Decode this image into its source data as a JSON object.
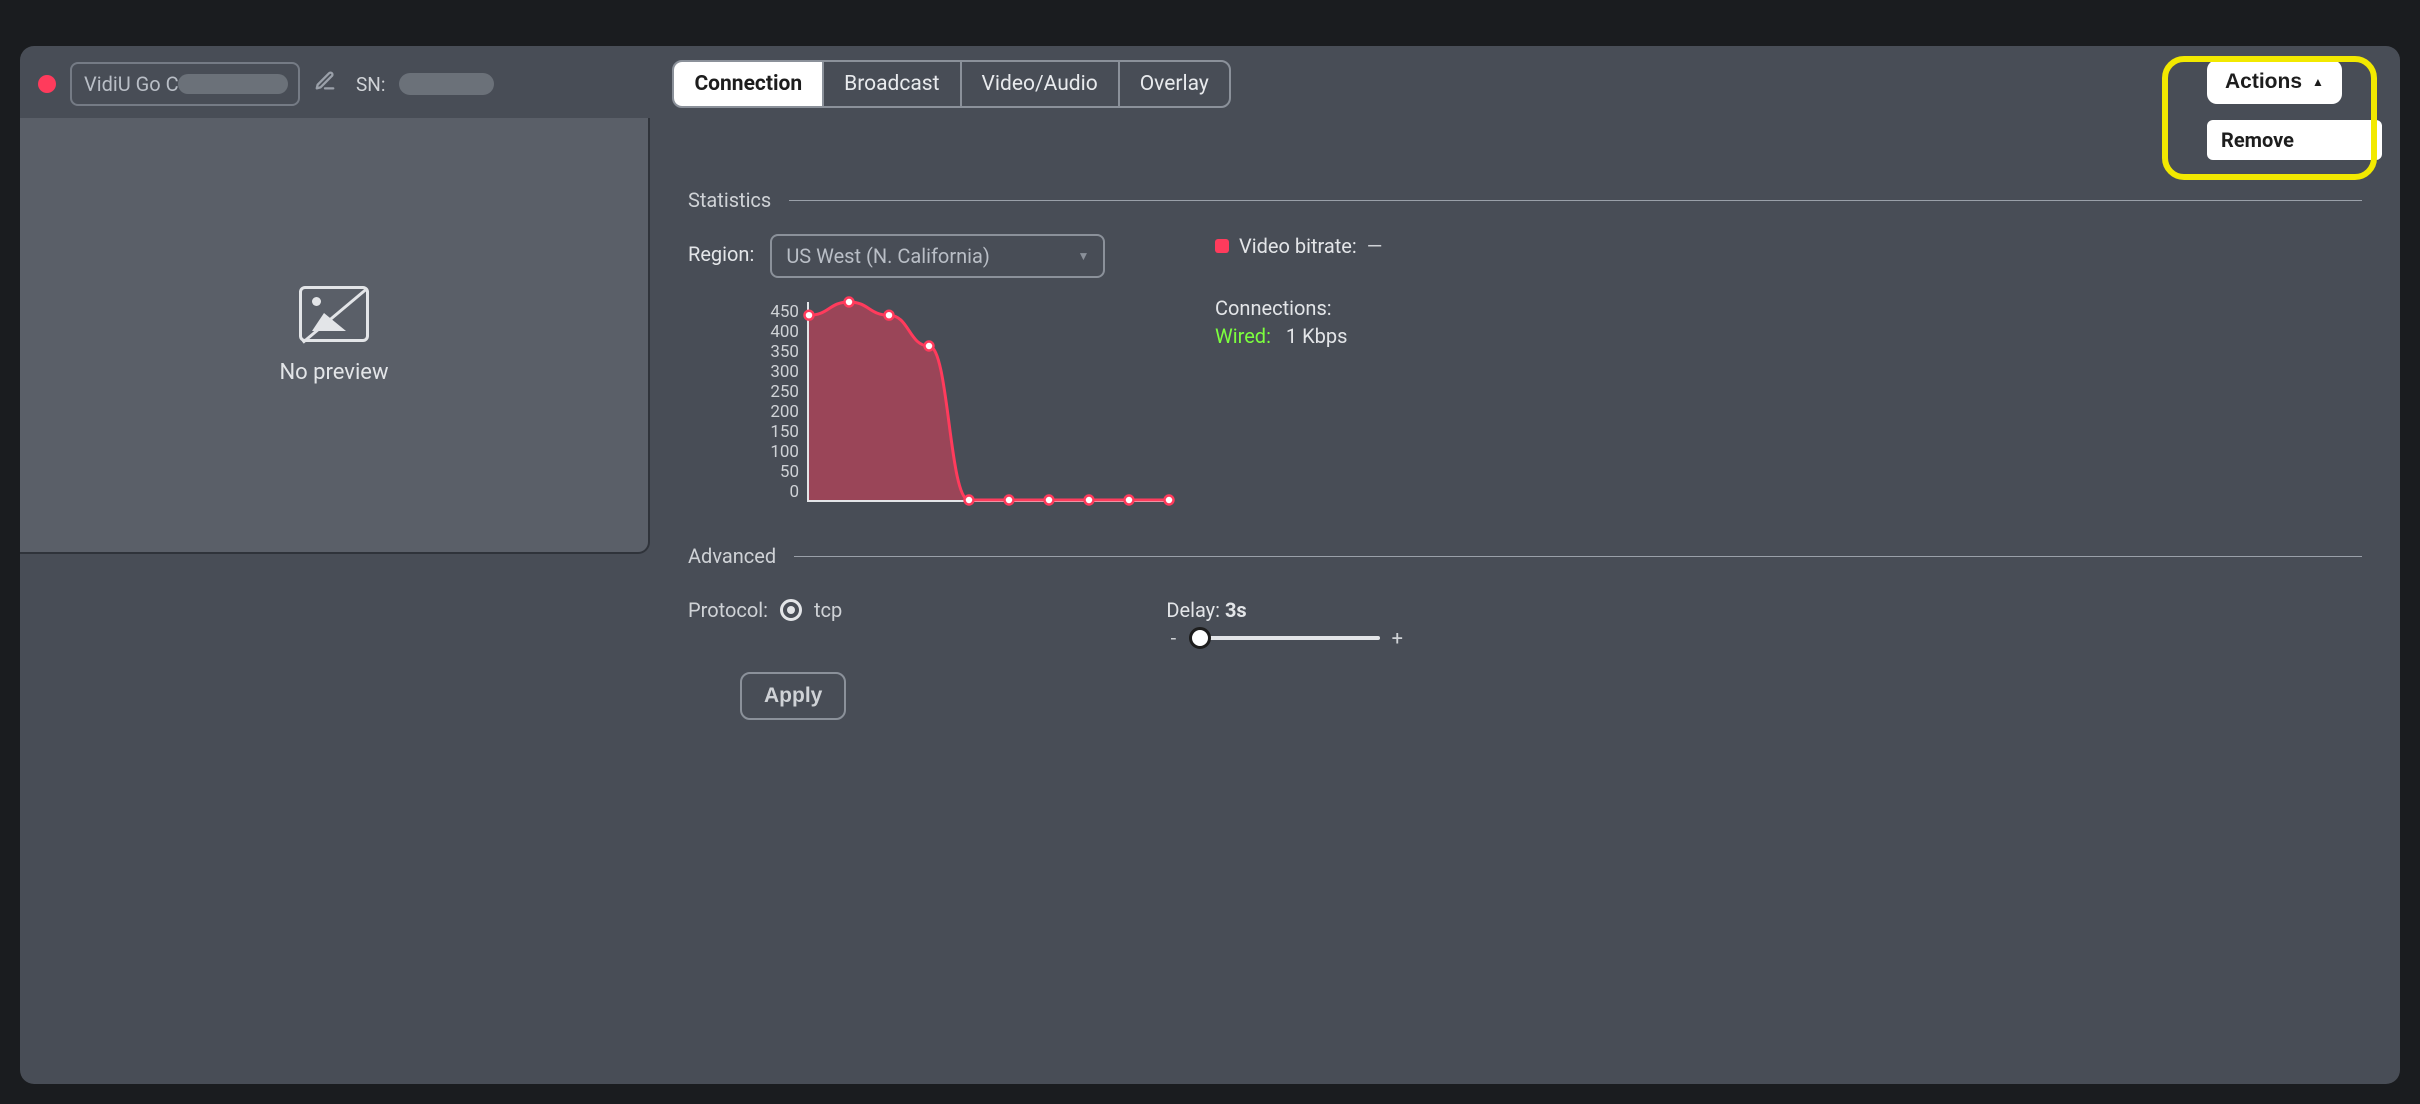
{
  "header": {
    "device_name_prefix": "VidiU Go C",
    "sn_label": "SN:"
  },
  "tabs": {
    "connection": "Connection",
    "broadcast": "Broadcast",
    "video_audio": "Video/Audio",
    "overlay": "Overlay"
  },
  "actions": {
    "button": "Actions",
    "menu_remove": "Remove"
  },
  "preview": {
    "no_preview": "No preview"
  },
  "statistics": {
    "title": "Statistics",
    "region_label": "Region:",
    "region_value": "US West (N. California)",
    "bitrate_label": "Video bitrate:",
    "bitrate_value": "—",
    "connections_label": "Connections:",
    "wired_label": "Wired:",
    "wired_value": "1 Kbps"
  },
  "chart_data": {
    "type": "area",
    "ylabel": "",
    "xlabel": "",
    "ylim": [
      0,
      450
    ],
    "y_ticks": [
      "450",
      "400",
      "350",
      "300",
      "250",
      "200",
      "150",
      "100",
      "50",
      "0"
    ],
    "series": [
      {
        "name": "Video bitrate",
        "color": "#ff3b5c",
        "values": [
          420,
          450,
          420,
          350,
          0,
          0,
          0,
          0,
          0,
          0
        ]
      }
    ]
  },
  "advanced": {
    "title": "Advanced",
    "protocol_label": "Protocol:",
    "protocol_value": "tcp",
    "delay_label": "Delay: ",
    "delay_value": "3s",
    "minus": "-",
    "plus": "+",
    "apply": "Apply"
  }
}
